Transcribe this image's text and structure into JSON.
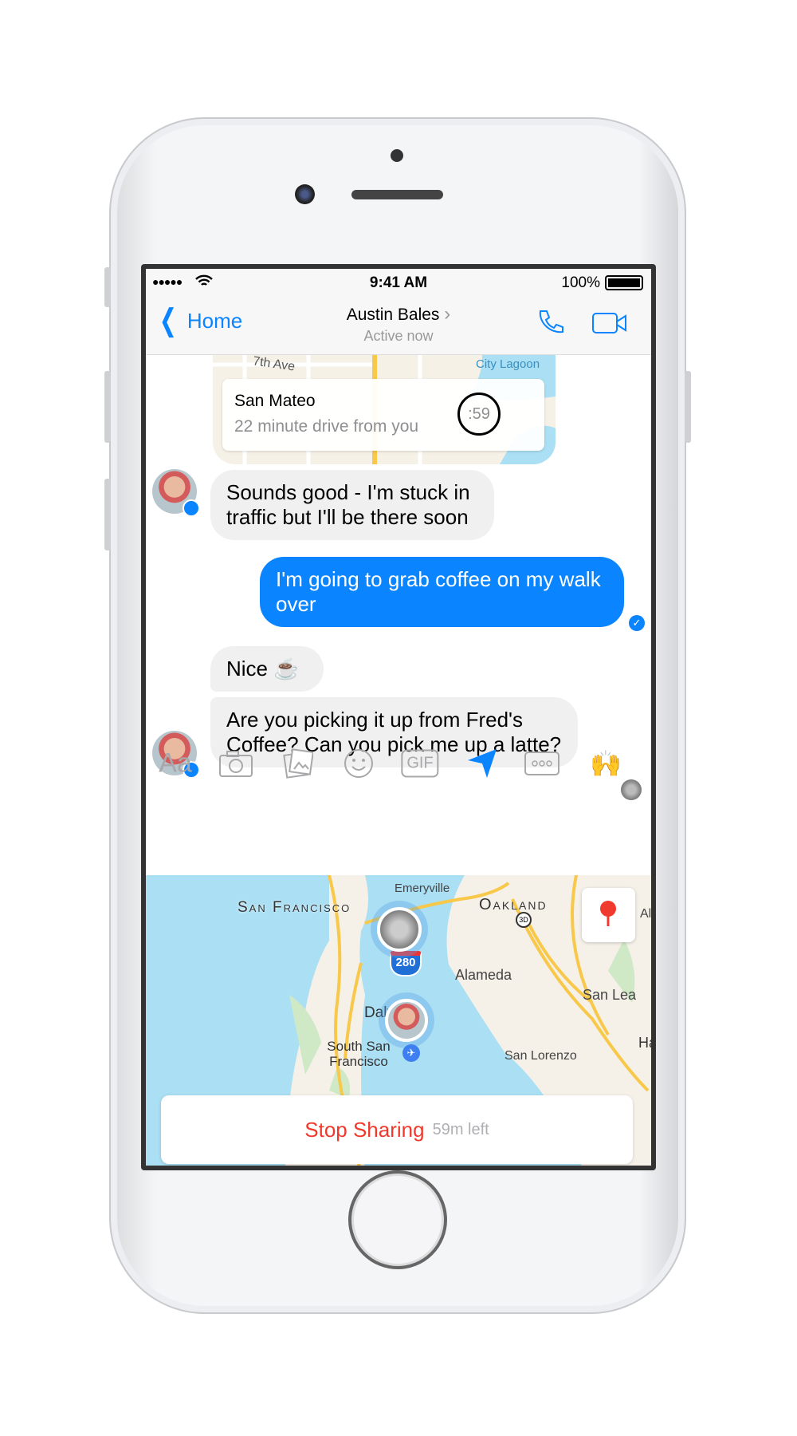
{
  "status_bar": {
    "time": "9:41 AM",
    "battery": "100%"
  },
  "nav": {
    "back_label": "Home",
    "contact_name": "Austin Bales",
    "chevron": "›",
    "presence": "Active now"
  },
  "location_card": {
    "place": "San Mateo",
    "detail": "22 minute drive from you",
    "timer": ":59",
    "map_labels": [
      "7th Ave",
      "City Lagoon"
    ]
  },
  "messages": [
    {
      "direction": "incoming",
      "text": "Sounds good - I'm stuck in traffic but I'll be there soon"
    },
    {
      "direction": "outgoing",
      "text": "I'm going to grab coffee on my walk over",
      "status": "delivered"
    },
    {
      "direction": "incoming",
      "text": "Nice ☕"
    },
    {
      "direction": "incoming",
      "text": "Are you picking it up from Fred's Coffee? Can you pick me up a latte?"
    }
  ],
  "toolbar": {
    "text_label": "Aa",
    "gif_label": "GIF",
    "hands_emoji": "🙌",
    "active_tool": "location"
  },
  "map": {
    "labels": {
      "sf": "San Francisco",
      "emeryville": "Emeryville",
      "oakland": "Oakland",
      "alameda": "Alameda",
      "daly": "Daly City",
      "ssf": "South San Francisco",
      "san_lorenzo": "San Lorenzo",
      "san_leandro": "San Lea",
      "ha": "Ha",
      "al": "Al",
      "highway": "280",
      "route": "3D"
    }
  },
  "sharing": {
    "stop_label": "Stop Sharing",
    "time_left": "59m left"
  },
  "colors": {
    "accent": "#0a84ff",
    "stop": "#f0392b",
    "water": "#aadff4",
    "land": "#f5f1e8",
    "road": "#f8c84a"
  }
}
